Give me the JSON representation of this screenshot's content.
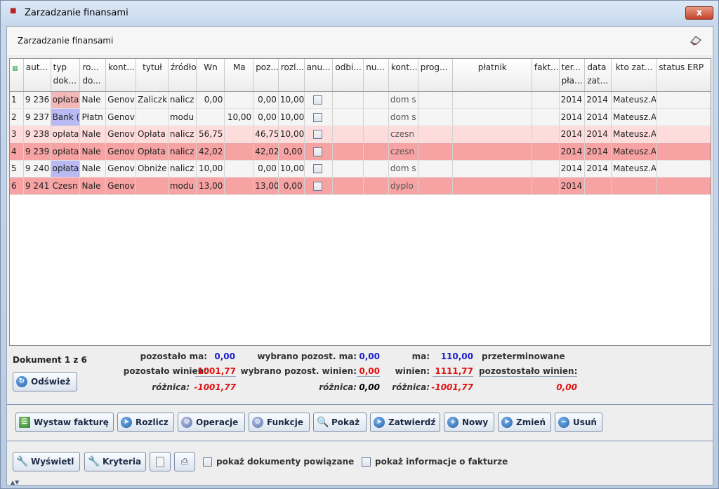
{
  "window": {
    "title": "Zarzadzanie finansami",
    "close_label": "x"
  },
  "panel": {
    "title": "Zarzadzanie finansami"
  },
  "columns": [
    "",
    "aut...",
    "typ dok...",
    "ro... do...",
    "kont...",
    "tytuł",
    "źródło",
    "Wn",
    "Ma",
    "poz...",
    "rozl...",
    "anu...",
    "odbi...",
    "nu...",
    "kont...",
    "prog...",
    "płatnik",
    "fakt...",
    "ter... pła...",
    "data zat...",
    "kto zat...",
    "status ERP"
  ],
  "rows": [
    {
      "n": "1",
      "aut": "9 236",
      "typ": "opłata",
      "ro": "Nale",
      "kont": "Genov",
      "tytul": "Zaliczk",
      "zrodlo": "nalicz",
      "wn": "0,00",
      "ma": "",
      "poz": "0,00",
      "rozl": "10,00",
      "kont2": "dom s",
      "ter": "2014",
      "data": "2014",
      "kto": "Mateusz.A",
      "style": "white",
      "typ_color": "pink"
    },
    {
      "n": "2",
      "aut": "9 237",
      "typ": "Bank (",
      "ro": "Płatn",
      "kont": "Genov",
      "tytul": "",
      "zrodlo": "modu",
      "wn": "",
      "ma": "10,00",
      "poz": "0,00",
      "rozl": "10,00",
      "kont2": "dom s",
      "ter": "2014",
      "data": "2014",
      "kto": "Mateusz.A",
      "style": "white",
      "typ_color": "blue"
    },
    {
      "n": "3",
      "aut": "9 238",
      "typ": "opłata",
      "ro": "Nale",
      "kont": "Genov",
      "tytul": "Opłata",
      "zrodlo": "nalicz",
      "wn": "56,75",
      "ma": "",
      "poz": "46,75",
      "rozl": "10,00",
      "kont2": "czesn",
      "ter": "2014",
      "data": "2014",
      "kto": "Mateusz.A",
      "style": "light",
      "typ_color": ""
    },
    {
      "n": "4",
      "aut": "9 239",
      "typ": "opłata",
      "ro": "Nale",
      "kont": "Genov",
      "tytul": "Opłata",
      "zrodlo": "nalicz",
      "wn": "42,02",
      "ma": "",
      "poz": "42,02",
      "rozl": "0,00",
      "kont2": "czesn",
      "ter": "2014",
      "data": "2014",
      "kto": "Mateusz.A",
      "style": "red",
      "typ_color": ""
    },
    {
      "n": "5",
      "aut": "9 240",
      "typ": "opłata",
      "ro": "Nale",
      "kont": "Genov",
      "tytul": "Obniże",
      "zrodlo": "nalicz",
      "wn": "10,00",
      "ma": "",
      "poz": "0,00",
      "rozl": "10,00",
      "kont2": "dom s",
      "ter": "2014",
      "data": "2014",
      "kto": "Mateusz.A",
      "style": "white",
      "typ_color": "blue"
    },
    {
      "n": "6",
      "aut": "9 241",
      "typ": "Czesn",
      "ro": "Nale",
      "kont": "Genov",
      "tytul": "",
      "zrodlo": "modu",
      "wn": "13,00",
      "ma": "",
      "poz": "13,00",
      "rozl": "0,00",
      "kont2": "dyplo",
      "ter": "2014",
      "data": "",
      "kto": "",
      "style": "red",
      "typ_color": ""
    }
  ],
  "summary": {
    "doc_count": "Dokument 1 z 6",
    "refresh": "Odśwież",
    "pozostalo_ma_label": "pozostało ma:",
    "pozostalo_ma": "0,00",
    "pozostalo_winien_label": "pozostało winien:",
    "pozostalo_winien": "1001,77",
    "roznica_label": "różnica:",
    "roznica1": "-1001,77",
    "wybrano_ma_label": "wybrano pozost. ma:",
    "wybrano_ma": "0,00",
    "wybrano_winien_label": "wybrano pozost. winien:",
    "wybrano_winien": "0,00",
    "roznica2": "0,00",
    "ma_label": "ma:",
    "ma": "110,00",
    "winien_label": "winien:",
    "winien": "1111,77",
    "roznica3": "-1001,77",
    "przeterminowane": "przeterminowane",
    "pozostostalo_winien_label": "pozostostało winien:",
    "przeterminowane_value": "0,00"
  },
  "actions": [
    "Wystaw fakturę",
    "Rozlicz",
    "Operacje",
    "Funkcje",
    "Pokaż",
    "Zatwierdź",
    "Nowy",
    "Zmień",
    "Usuń"
  ],
  "bottom": {
    "wyswietl": "Wyświetl",
    "kryteria": "Kryteria",
    "powiazane": "pokaż dokumenty powiązane",
    "info_faktura": "pokaż informacje o fakturze"
  }
}
